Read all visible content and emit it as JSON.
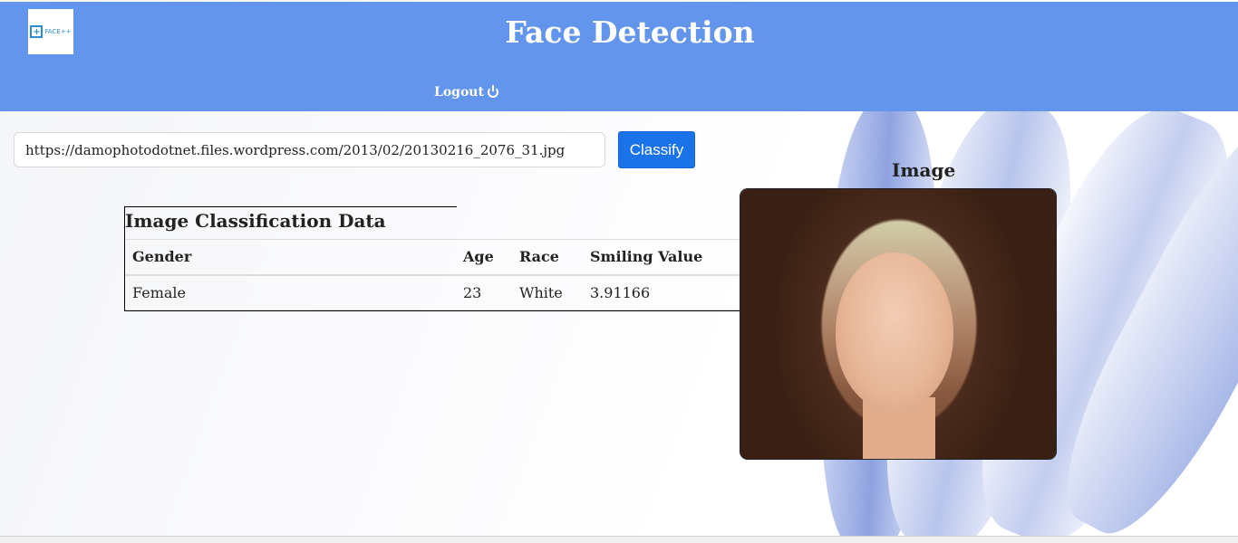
{
  "header": {
    "logo_text": "FACE++",
    "title": "Face Detection",
    "logout_label": "Logout"
  },
  "search": {
    "url_value": "https://damophotodotnet.files.wordpress.com/2013/02/20130216_2076_31.jpg",
    "classify_label": "Classify"
  },
  "results": {
    "heading": "Image Classification Data",
    "columns": [
      "Gender",
      "Age",
      "Race",
      "Smiling Value"
    ],
    "rows": [
      [
        "Female",
        "23",
        "White",
        "3.91166"
      ]
    ]
  },
  "image_panel": {
    "label": "Image"
  },
  "colors": {
    "header_bg": "#6495ed",
    "button_bg": "#1a73e8"
  },
  "icons": {
    "logout": "power-icon",
    "logo": "face-plus-plus-logo"
  }
}
